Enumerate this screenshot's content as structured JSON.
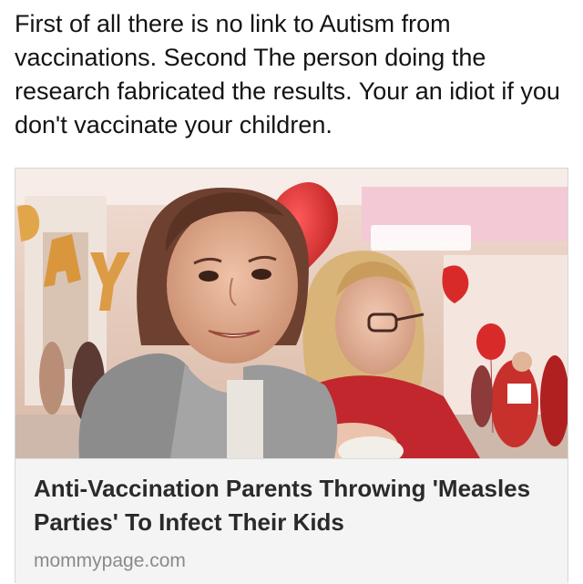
{
  "post": {
    "text": "First of all there is no link to Autism from vaccinations. Second The person doing the research fabricated the results. Your an idiot if you don't vaccinate your children."
  },
  "link_card": {
    "headline": "Anti-Vaccination Parents Throwing 'Measles Parties' To Infect Their Kids",
    "domain": "mommypage.com",
    "thumbnail_icon": "news-photo-thumbnail"
  },
  "colors": {
    "card_background": "#f4f4f5",
    "headline": "#2a2a2a",
    "domain": "#8a8a8a",
    "balloon_red": "#d92a2a",
    "balloon_gold": "#e2a64a"
  }
}
